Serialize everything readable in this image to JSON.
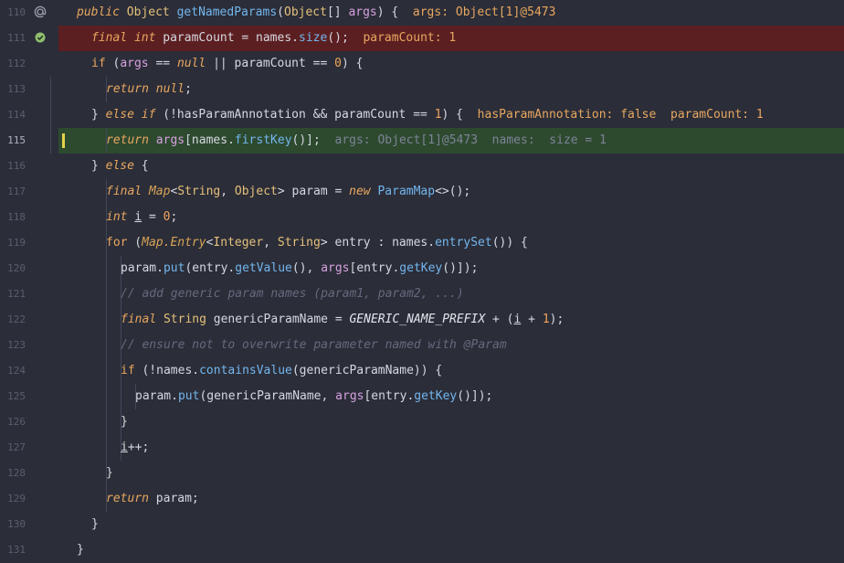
{
  "editor": {
    "lines": [
      {
        "n": "110",
        "icon": "at-icon",
        "bg": "",
        "indent": 0,
        "tokens": [
          [
            "kw",
            "public"
          ],
          [
            " ",
            ""
          ],
          [
            "typ",
            "Object"
          ],
          [
            " ",
            ""
          ],
          [
            "fn",
            "getNamedParams"
          ],
          [
            "p",
            "("
          ],
          [
            "typ",
            "Object"
          ],
          [
            "p",
            "[]"
          ],
          [
            " ",
            ""
          ],
          [
            "var",
            "args"
          ],
          [
            "p",
            ") {  "
          ],
          [
            "inline",
            "args: Object[1]@5473"
          ]
        ]
      },
      {
        "n": "111",
        "icon": "breakpoint-check-icon",
        "bg": "#5c1f21",
        "indent": 1,
        "tokens": [
          [
            "kw",
            "final"
          ],
          [
            " ",
            ""
          ],
          [
            "kw",
            "int"
          ],
          [
            " ",
            ""
          ],
          [
            "p",
            "paramCount = names."
          ],
          [
            "fn",
            "size"
          ],
          [
            "p",
            "();  "
          ],
          [
            "inline",
            "paramCount: 1"
          ]
        ]
      },
      {
        "n": "112",
        "icon": "",
        "bg": "",
        "indent": 1,
        "tokens": [
          [
            "kw2",
            "if"
          ],
          [
            "p",
            " ("
          ],
          [
            "var",
            "args"
          ],
          [
            "p",
            " == "
          ],
          [
            "kw",
            "null"
          ],
          [
            "p",
            " || paramCount == "
          ],
          [
            "num",
            "0"
          ],
          [
            "p",
            ") {"
          ]
        ]
      },
      {
        "n": "113",
        "icon": "",
        "bg": "",
        "indent": 2,
        "tokens": [
          [
            "kw",
            "return"
          ],
          [
            " ",
            ""
          ],
          [
            "kw",
            "null"
          ],
          [
            "p",
            ";"
          ]
        ]
      },
      {
        "n": "114",
        "icon": "",
        "bg": "",
        "indent": 1,
        "tokens": [
          [
            "p",
            "} "
          ],
          [
            "kw",
            "else"
          ],
          [
            " ",
            ""
          ],
          [
            "kw",
            "if"
          ],
          [
            "p",
            " (!hasParamAnnotation && paramCount == "
          ],
          [
            "num",
            "1"
          ],
          [
            "p",
            ") {  "
          ],
          [
            "inline",
            "hasParamAnnotation: false  paramCount: 1"
          ]
        ]
      },
      {
        "n": "115",
        "icon": "",
        "bg": "#2d4a2f",
        "indent": 2,
        "active": true,
        "tokens": [
          [
            "kw",
            "return"
          ],
          [
            " ",
            ""
          ],
          [
            "var",
            "args"
          ],
          [
            "p",
            "[names."
          ],
          [
            "fn",
            "firstKey"
          ],
          [
            "p",
            "()];  "
          ],
          [
            "inline2",
            "args: Object[1]@5473  names:  size = 1"
          ]
        ]
      },
      {
        "n": "116",
        "icon": "",
        "bg": "",
        "indent": 1,
        "tokens": [
          [
            "p",
            "} "
          ],
          [
            "kw",
            "else"
          ],
          [
            "p",
            " {"
          ]
        ]
      },
      {
        "n": "117",
        "icon": "",
        "bg": "",
        "indent": 2,
        "tokens": [
          [
            "kw",
            "final"
          ],
          [
            " ",
            ""
          ],
          [
            "cls",
            "Map"
          ],
          [
            "p",
            "<"
          ],
          [
            "typ",
            "String"
          ],
          [
            "p",
            ", "
          ],
          [
            "typ",
            "Object"
          ],
          [
            "p",
            "> param = "
          ],
          [
            "kw",
            "new"
          ],
          [
            " ",
            ""
          ],
          [
            "fn",
            "ParamMap"
          ],
          [
            "p",
            "<>();"
          ]
        ]
      },
      {
        "n": "118",
        "icon": "",
        "bg": "",
        "indent": 2,
        "tokens": [
          [
            "kw",
            "int"
          ],
          [
            " ",
            ""
          ],
          [
            "und",
            "i"
          ],
          [
            "p",
            " = "
          ],
          [
            "num",
            "0"
          ],
          [
            "p",
            ";"
          ]
        ]
      },
      {
        "n": "119",
        "icon": "",
        "bg": "",
        "indent": 2,
        "tokens": [
          [
            "kw2",
            "for"
          ],
          [
            "p",
            " ("
          ],
          [
            "cls",
            "Map.Entry"
          ],
          [
            "p",
            "<"
          ],
          [
            "typ",
            "Integer"
          ],
          [
            "p",
            ", "
          ],
          [
            "typ",
            "String"
          ],
          [
            "p",
            "> entry : names."
          ],
          [
            "fn",
            "entrySet"
          ],
          [
            "p",
            "()) {"
          ]
        ]
      },
      {
        "n": "120",
        "icon": "",
        "bg": "",
        "indent": 3,
        "tokens": [
          [
            "p",
            "param."
          ],
          [
            "fn",
            "put"
          ],
          [
            "p",
            "(entry."
          ],
          [
            "fn",
            "getValue"
          ],
          [
            "p",
            "(), "
          ],
          [
            "var",
            "args"
          ],
          [
            "p",
            "[entry."
          ],
          [
            "fn",
            "getKey"
          ],
          [
            "p",
            "()]);"
          ]
        ]
      },
      {
        "n": "121",
        "icon": "",
        "bg": "",
        "indent": 3,
        "tokens": [
          [
            "cmt",
            "// add generic param names (param1, param2, ...)"
          ]
        ]
      },
      {
        "n": "122",
        "icon": "",
        "bg": "",
        "indent": 3,
        "tokens": [
          [
            "kw",
            "final"
          ],
          [
            " ",
            ""
          ],
          [
            "typ",
            "String"
          ],
          [
            "p",
            " genericParamName = "
          ],
          [
            "cst",
            "GENERIC_NAME_PREFIX"
          ],
          [
            "p",
            " + ("
          ],
          [
            "und",
            "i"
          ],
          [
            "p",
            " + "
          ],
          [
            "num",
            "1"
          ],
          [
            "p",
            ");"
          ]
        ]
      },
      {
        "n": "123",
        "icon": "",
        "bg": "",
        "indent": 3,
        "tokens": [
          [
            "cmt",
            "// ensure not to overwrite parameter named with @Param"
          ]
        ]
      },
      {
        "n": "124",
        "icon": "",
        "bg": "",
        "indent": 3,
        "tokens": [
          [
            "kw2",
            "if"
          ],
          [
            "p",
            " (!names."
          ],
          [
            "fn",
            "containsValue"
          ],
          [
            "p",
            "(genericParamName)) {"
          ]
        ]
      },
      {
        "n": "125",
        "icon": "",
        "bg": "",
        "indent": 4,
        "tokens": [
          [
            "p",
            "param."
          ],
          [
            "fn",
            "put"
          ],
          [
            "p",
            "(genericParamName, "
          ],
          [
            "var",
            "args"
          ],
          [
            "p",
            "[entry."
          ],
          [
            "fn",
            "getKey"
          ],
          [
            "p",
            "()]);"
          ]
        ]
      },
      {
        "n": "126",
        "icon": "",
        "bg": "",
        "indent": 3,
        "tokens": [
          [
            "p",
            "}"
          ]
        ]
      },
      {
        "n": "127",
        "icon": "",
        "bg": "",
        "indent": 3,
        "tokens": [
          [
            "und",
            "i"
          ],
          [
            "p",
            "++;"
          ]
        ]
      },
      {
        "n": "128",
        "icon": "",
        "bg": "",
        "indent": 2,
        "tokens": [
          [
            "p",
            "}"
          ]
        ]
      },
      {
        "n": "129",
        "icon": "",
        "bg": "",
        "indent": 2,
        "tokens": [
          [
            "kw",
            "return"
          ],
          [
            "p",
            " param;"
          ]
        ]
      },
      {
        "n": "130",
        "icon": "",
        "bg": "",
        "indent": 1,
        "tokens": [
          [
            "p",
            "}"
          ]
        ]
      },
      {
        "n": "131",
        "icon": "",
        "bg": "",
        "indent": 0,
        "tokens": [
          [
            "p",
            "}"
          ]
        ]
      }
    ]
  }
}
